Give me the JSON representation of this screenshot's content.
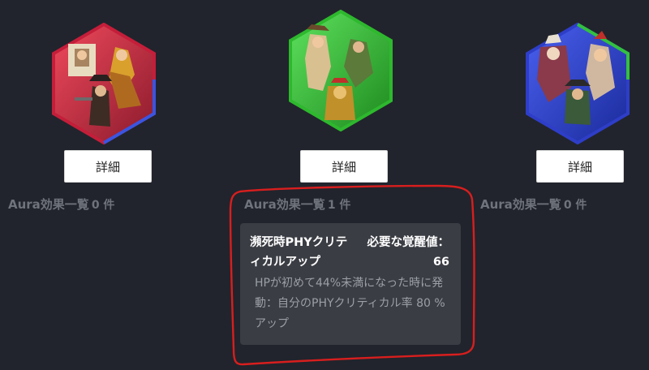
{
  "colors": {
    "background": "#21242c",
    "card": "#3a3d43",
    "annotation": "#d81e1e",
    "hex_red": "#d8324a",
    "hex_green": "#3ec43e",
    "hex_blue": "#2e43c8"
  },
  "units": [
    {
      "detail_label": "詳細",
      "aura_label": "Aura効果一覧",
      "aura_count": "0 件",
      "frame_color": "red"
    },
    {
      "detail_label": "詳細",
      "aura_label": "Aura効果一覧",
      "aura_count": "1 件",
      "frame_color": "green"
    },
    {
      "detail_label": "詳細",
      "aura_label": "Aura効果一覧",
      "aura_count": "0 件",
      "frame_color": "blue"
    }
  ],
  "effect": {
    "name": "瀕死時PHYクリティカルアップ",
    "required_label": "必要な覚醒値：",
    "required_value": "66",
    "description": "HPが初めて44%未満になった時に発動：自分のPHYクリティカル率 80 %アップ"
  },
  "icons": [
    "character-portrait-icon",
    "character-portrait-icon",
    "character-portrait-icon"
  ]
}
